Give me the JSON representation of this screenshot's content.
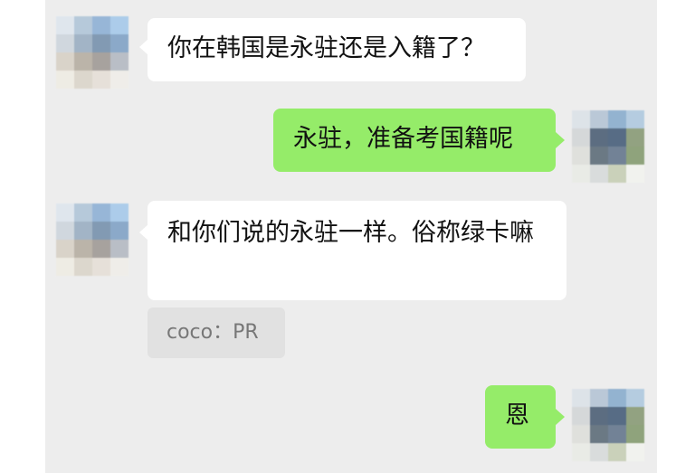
{
  "messages": [
    {
      "sender": "other",
      "text": "你在韩国是永驻还是入籍了？"
    },
    {
      "sender": "me",
      "text": "永驻，准备考国籍呢"
    },
    {
      "sender": "other",
      "text": "和你们说的永驻一样。俗称绿卡嘛",
      "quote": "coco：PR"
    },
    {
      "sender": "me",
      "text": "恩"
    }
  ],
  "avatars": {
    "other_colors": [
      "#dfe6ee",
      "#b4c8da",
      "#93b4d6",
      "#a9cbea",
      "#cfd6de",
      "#9fb2c4",
      "#7d96b0",
      "#86a6c8",
      "#d8d2c8",
      "#b9b2a6",
      "#a49e9a",
      "#b7bcc4",
      "#efece4",
      "#dcd6cc",
      "#e6e0d8",
      "#f0eee9"
    ],
    "me_colors": [
      "#dde3e8",
      "#b8c7d6",
      "#8fb0cf",
      "#b3cbe0",
      "#d4d7d8",
      "#55677c",
      "#4f6680",
      "#8e9f7c",
      "#dfe0dc",
      "#65737f",
      "#6c7d92",
      "#8aa076",
      "#e9ebe6",
      "#d8dcdc",
      "#c9d0b8",
      "#f2f3ef"
    ]
  }
}
